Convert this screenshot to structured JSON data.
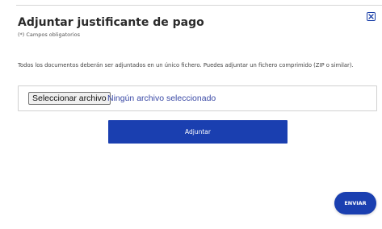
{
  "modal": {
    "title": "Adjuntar justificante de pago",
    "required_note": "(*) Campos obligatorios",
    "close_icon": "close-icon",
    "instructions": "Todos los documentos deberán ser adjuntados en un único fichero. Puedes adjuntar un fichero comprimido (ZIP o similar).",
    "file_input": {
      "button_label": "Seleccionar archivo",
      "status": "Ningún archivo seleccionado"
    },
    "attach_button_label": "Adjuntar"
  },
  "footer": {
    "send_button_label": "ENVIAR"
  },
  "colors": {
    "primary": "#1a3fb0",
    "file_status_text": "#3b4aa6",
    "border": "#d0d0d0"
  }
}
